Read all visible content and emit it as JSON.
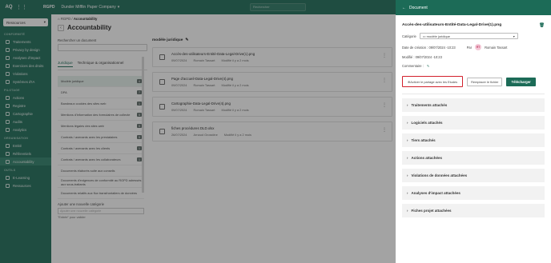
{
  "topbar": {
    "logo": "AQ",
    "tenant": "RGPD",
    "company": "Dunder Mifflin Paper Company",
    "search_placeholder": "Rechercher"
  },
  "sidebar": {
    "ressources": "Ressources",
    "sections": [
      {
        "title": "CONFORMITÉ",
        "items": [
          "Traitements",
          "Privacy by design",
          "Analyses d'impact",
          "Exercices des droits",
          "Violations",
          "Systèmes d'IA"
        ]
      },
      {
        "title": "PILOTAGE",
        "items": [
          "Actions",
          "Registre",
          "Cartographie",
          "Audits",
          "Analytics"
        ]
      },
      {
        "title": "ORGANISATION",
        "items": [
          "Entité",
          "Référentiels",
          "Accountability"
        ]
      },
      {
        "title": "OUTILS",
        "items": [
          "E-Learning",
          "Ressources"
        ]
      }
    ]
  },
  "main": {
    "breadcrumb_root": "RGPD",
    "breadcrumb_page": "Accountability",
    "title": "Accountability",
    "search_label": "Rechercher un document",
    "tabs": [
      "Juridique",
      "Technique & organisationnel"
    ],
    "categories": [
      {
        "label": "Modèle juridique",
        "count": "4"
      },
      {
        "label": "DPA",
        "count": "7"
      },
      {
        "label": "Bandeaux cookies des sites web",
        "count": "1"
      },
      {
        "label": "Mentions d'information des formulaires de collecte",
        "count": "5"
      },
      {
        "label": "Mentions légales des sites web",
        "count": "5"
      },
      {
        "label": "Contrats / avenants avec les prestataires",
        "count": "5"
      },
      {
        "label": "Contrats / avenants avec les clients",
        "count": "1"
      },
      {
        "label": "Contrats / avenants avec les collaborateurs",
        "count": "1"
      },
      {
        "label": "Documents élaborés suite aux conseils",
        "count": ""
      },
      {
        "label": "Documents d'exigences de conformité au RGPD adressés aux sous-traitants",
        "count": ""
      },
      {
        "label": "Documents relatifs aux flux transfrontaliers de données",
        "count": ""
      }
    ],
    "add_category_label": "Ajouter une nouvelle catégorie",
    "add_category_placeholder": "Ajouter une nouvelle catégorie",
    "add_category_hint": "\"Entrée\" pour valider",
    "folder_title": "modèle juridique",
    "files": [
      {
        "name": "Accès-des-utilisateurs-Entité-Data-Legal-Drive(1).png",
        "date": "09/07/2024",
        "author": "Romain Tassart",
        "modified": "Modifié il y a 2 mois"
      },
      {
        "name": "Page d'accueil-Data-Legal-Drive(4).png",
        "date": "09/07/2024",
        "author": "Romain Tassart",
        "modified": "Modifié il y a 2 mois"
      },
      {
        "name": "Cartographie-Data-Legal-Drive(4).png",
        "date": "09/07/2024",
        "author": "Romain Tassart",
        "modified": "Modifié il y a 2 mois"
      },
      {
        "name": "fiches procédures DLD.xlsx",
        "date": "26/07/2024",
        "author": "Arnaud Grosstine",
        "modified": "Modifié il y a 2 mois"
      }
    ]
  },
  "panel": {
    "title": "Document",
    "doc_name": "Accès-des-utilisateurs-Entité-Data-Legal-Drive(1).png",
    "category_label": "Catégorie",
    "category_value": "modèle juridique",
    "created_label": "Date de création : 09/07/2024 -10:23",
    "by_label": "Par",
    "author_initials": "RT",
    "author_name": "Romain Tassart",
    "modified_label": "Modifié : 09/07/2024 -10:23",
    "comment_label": "Commentaire :",
    "share_button": "Activer le partage avec les Etudes",
    "replace_button": "Remplacer le fichier",
    "download_button": "Télécharger",
    "sections": [
      "Traitements attachés",
      "Logiciels attachés",
      "Tiers attachés",
      "Actions attachées",
      "Violations de données attachées",
      "Analyses d'impact attachées",
      "Fiches projet attachées"
    ],
    "colors": {
      "brand": "#1c6b57",
      "highlight": "#d2202c"
    }
  }
}
